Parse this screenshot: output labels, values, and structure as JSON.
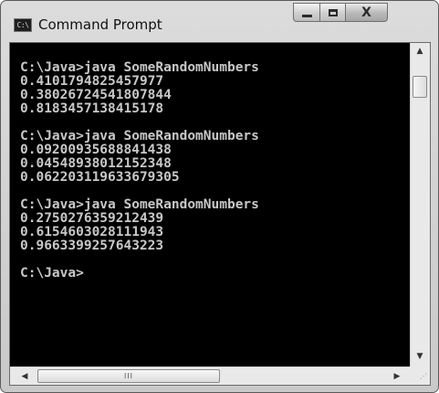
{
  "window": {
    "title": "Command Prompt",
    "icon": "console-app-icon",
    "icon_text": "C:\\",
    "buttons": {
      "minimize": "minimize-icon",
      "maximize": "maximize-icon",
      "close": "close-icon",
      "close_glyph": "X"
    }
  },
  "console": {
    "lines": [
      "C:\\Java>java SomeRandomNumbers",
      "0.4101794825457977",
      "0.38026724541807844",
      "0.8183457138415178",
      "",
      "C:\\Java>java SomeRandomNumbers",
      "0.09200935688841438",
      "0.04548938012152348",
      "0.062203119633679305",
      "",
      "C:\\Java>java SomeRandomNumbers",
      "0.2750276359212439",
      "0.6154603028111943",
      "0.9663399257643223",
      "",
      "C:\\Java>"
    ],
    "text_color": "#c8c8c8",
    "background_color": "#000000"
  },
  "scrollbars": {
    "vertical_up_arrow": "▲",
    "vertical_down_arrow": "▼",
    "horizontal_left_arrow": "◀",
    "horizontal_right_arrow": "▶",
    "horizontal_grip": "III",
    "size_grip": "⋰"
  }
}
